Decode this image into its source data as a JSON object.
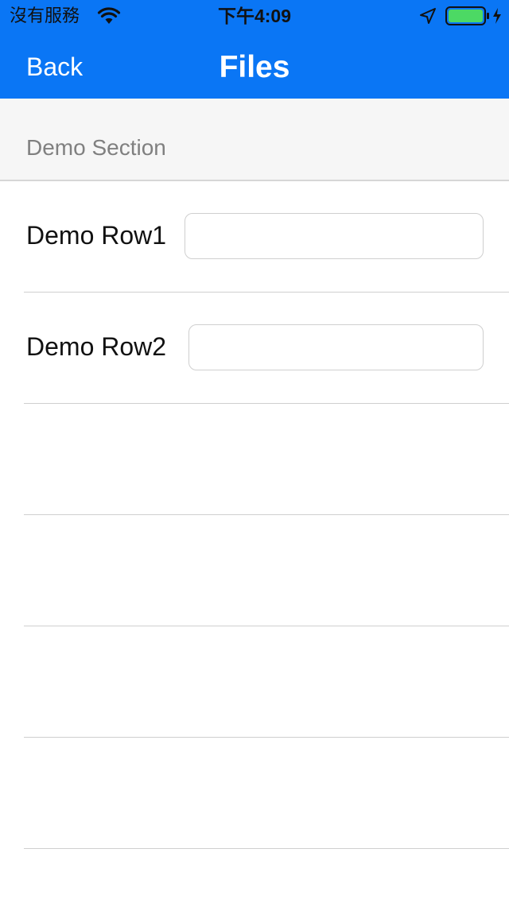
{
  "status_bar": {
    "carrier": "沒有服務",
    "time": "下午4:09",
    "icons": [
      "wifi-icon",
      "location-icon",
      "battery-icon",
      "charging-icon"
    ]
  },
  "nav_bar": {
    "back_label": "Back",
    "title": "Files"
  },
  "section": {
    "title": "Demo Section"
  },
  "rows": [
    {
      "label": "Demo Row1",
      "value": "",
      "placeholder": ""
    },
    {
      "label": "Demo Row2",
      "value": "",
      "placeholder": ""
    }
  ],
  "colors": {
    "nav_background": "#0a76f5",
    "section_background": "#f6f6f6",
    "battery_fill": "#4cd964"
  }
}
